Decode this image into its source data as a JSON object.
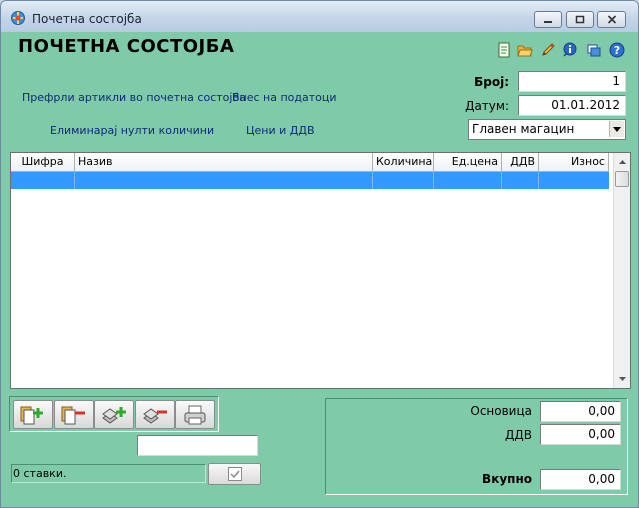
{
  "window": {
    "title": "Почетна состојба",
    "controls": [
      "minimize-icon",
      "maximize-icon",
      "close-icon"
    ]
  },
  "header": {
    "heading": "ПОЧЕТНА СОСТОЈБА",
    "toolbar_icons": [
      "document-icon",
      "folder-open-icon",
      "pencil-icon",
      "info-help-icon",
      "windows-icon",
      "help-icon"
    ]
  },
  "links": {
    "transfer_items": "Префрли артикли во почетна состојба",
    "enter_data": "Внес на податоци",
    "remove_zero": "Елиминарај нулти количини",
    "prices_vat": "Цени и  ДДВ"
  },
  "form": {
    "number_label": "Број:",
    "number_value": "1",
    "date_label": "Датум:",
    "date_value": "01.01.2012",
    "warehouse_value": "Главен магацин"
  },
  "grid": {
    "columns": [
      "Шифра",
      "Назив",
      "Количина",
      "Ед.цена",
      "ДДВ",
      "Износ"
    ],
    "rows": []
  },
  "bottom": {
    "toolbar_icons": [
      "add-item-icon",
      "remove-item-icon",
      "add-stack-icon",
      "remove-stack-icon",
      "print-icon"
    ],
    "status_text": "0 ставки.",
    "filter_value": ""
  },
  "totals": {
    "base_label": "Основица",
    "base_value": "0,00",
    "vat_label": "ДДВ",
    "vat_value": "0,00",
    "total_label": "Вкупно",
    "total_value": "0,00"
  },
  "colors": {
    "background": "#7fcaa8",
    "link": "#0e2a78",
    "selection": "#3399ff"
  }
}
